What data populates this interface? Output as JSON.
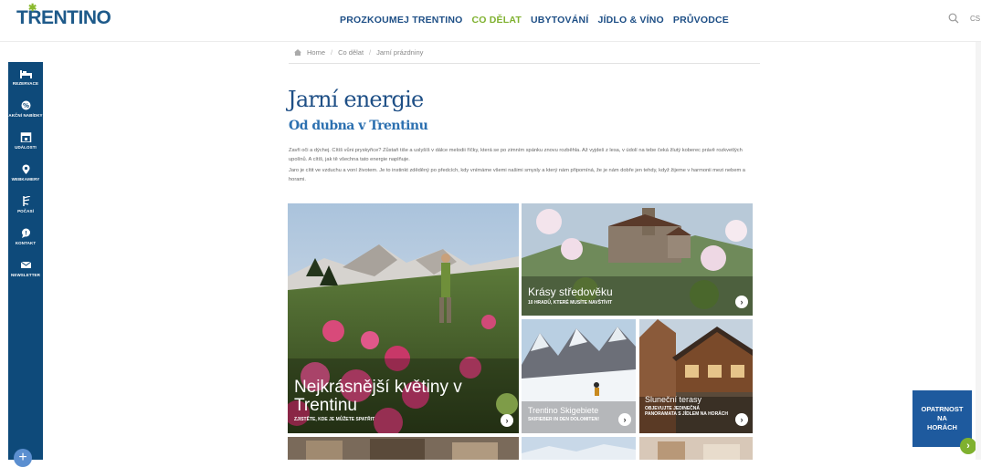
{
  "header": {
    "logo_main": "TRENTINO",
    "nav": [
      "PROZKOUMEJ TRENTINO",
      "CO DĚLAT",
      "UBYTOVÁNÍ",
      "JÍDLO & VÍNO",
      "PRŮVODCE"
    ],
    "active_nav": "CO DĚLAT",
    "lang": "CS"
  },
  "sidebar": {
    "items": [
      {
        "label": "REZERVACE",
        "icon": "bed-icon"
      },
      {
        "label": "AKČNÍ NABÍDKY",
        "icon": "percent-icon"
      },
      {
        "label": "UDÁLOSTI",
        "icon": "calendar-icon"
      },
      {
        "label": "WEBKAMERY",
        "icon": "camera-pin-icon"
      },
      {
        "label": "POČASÍ",
        "icon": "weather-icon"
      },
      {
        "label": "KONTAKT",
        "icon": "chat-icon"
      },
      {
        "label": "NEWSLETTER",
        "icon": "mail-icon"
      }
    ],
    "plus": "+"
  },
  "breadcrumb": {
    "home": "Home",
    "level1": "Co dělat",
    "level2": "Jarní prázdniny"
  },
  "page": {
    "title": "Jarní energie",
    "subtitle": "Od dubna v Trentinu",
    "para1": "Zavři oči a dýchej. Cítíš vůni pryskyřice? Zůstaň tiše a uslyšíš v dálce melodii říčky, která se po zimním spánku znovu rozběhla. Až vyjdeš z lesa, v údolí na tebe čeká žlutý koberec právě rozkvetlých upolínů. A cítíš, jak tě všechna tato energie naplňuje.",
    "para2": "Jaro je cítit ve vzduchu a voní životem. Je to instinkt zděděný po předcích, kdy vnímáme všemi našimi smysly a který nám připomíná, že je nám dobře jen tehdy, když žijeme v harmonii mezi nebem a horami."
  },
  "tiles": [
    {
      "title": "Nejkrásnější květiny v Trentinu",
      "sub": "ZJISTĚTE, KDE JE MŮŽETE SPATŘIT"
    },
    {
      "title": "Krásy středověku",
      "sub": "10 HRADŮ, KTERÉ MUSÍTE NAVŠTÍVIT"
    },
    {
      "title": "Trentino Skigebiete",
      "sub": "SKIFIEBER IN DEN DOLOMITEN!"
    },
    {
      "title": "Sluneční terasy",
      "sub": "OBJEVUJTE JEDINEČNÁ PANORAMATA S JÍDLEM NA HORÁCH"
    }
  ],
  "safety": {
    "line1": "OPATRNOST",
    "line2": "NA",
    "line3": "HORÁCH"
  },
  "colors": {
    "brand_blue": "#1e4f86",
    "brand_green": "#7fb12f",
    "sidebar": "#0e4a7a"
  }
}
